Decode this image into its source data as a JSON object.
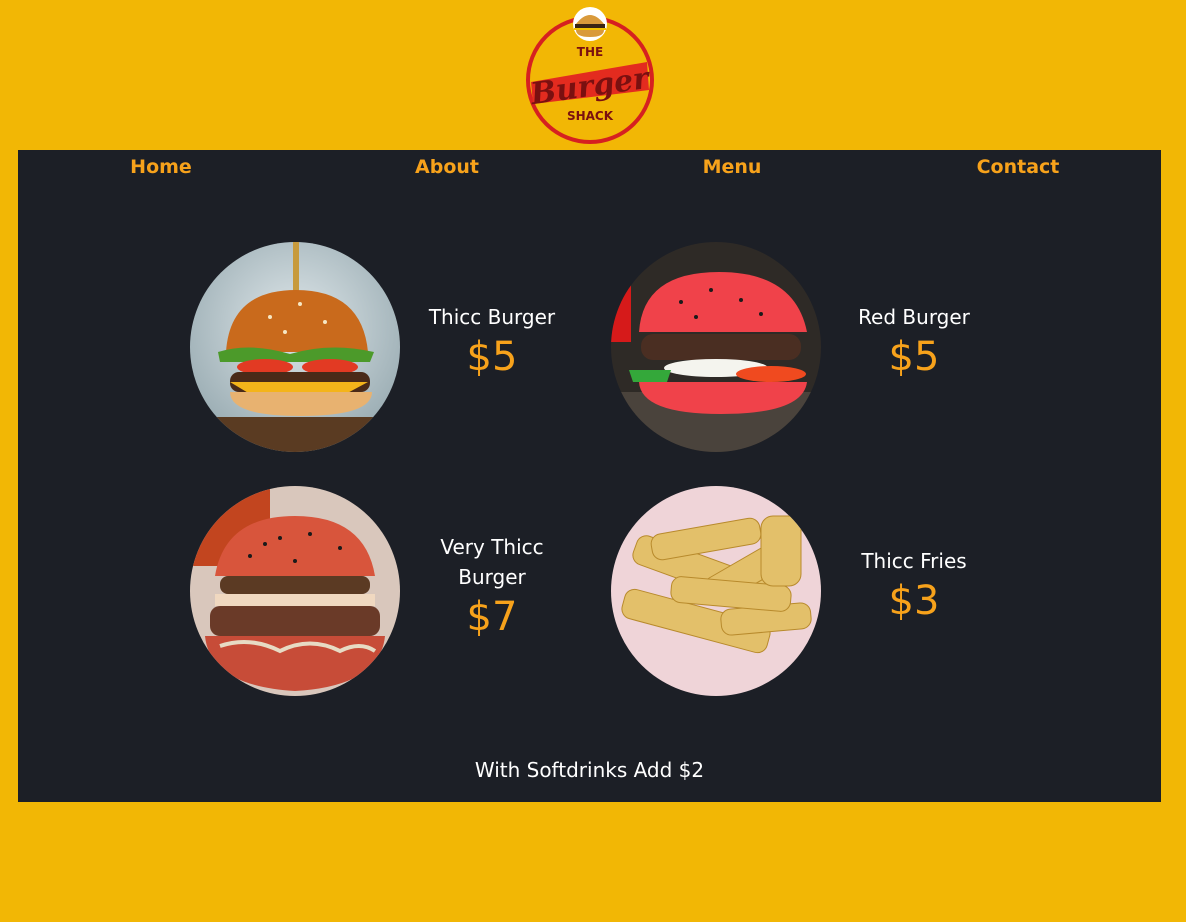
{
  "logo": {
    "line_top": "THE",
    "line_middle": "Burger",
    "line_bottom": "SHACK",
    "icon": "burger-icon",
    "ring_color": "#d62020",
    "text_color": "#7a1010"
  },
  "nav": {
    "items": [
      {
        "label": "Home"
      },
      {
        "label": "About"
      },
      {
        "label": "Menu"
      },
      {
        "label": "Contact"
      }
    ]
  },
  "menu": {
    "items": [
      {
        "name": "Thicc Burger",
        "price": "$5",
        "image": "burger-photo"
      },
      {
        "name": "Red Burger",
        "price": "$5",
        "image": "red-burger-photo"
      },
      {
        "name": "Very Thicc Burger",
        "price": "$7",
        "image": "very-thicc-burger-photo"
      },
      {
        "name": "Thicc Fries",
        "price": "$3",
        "image": "fries-photo"
      }
    ],
    "note": "With Softdrinks Add $2"
  },
  "colors": {
    "background": "#f2b705",
    "panel": "#1c1f26",
    "accent": "#f7a21b",
    "text": "#ffffff"
  }
}
